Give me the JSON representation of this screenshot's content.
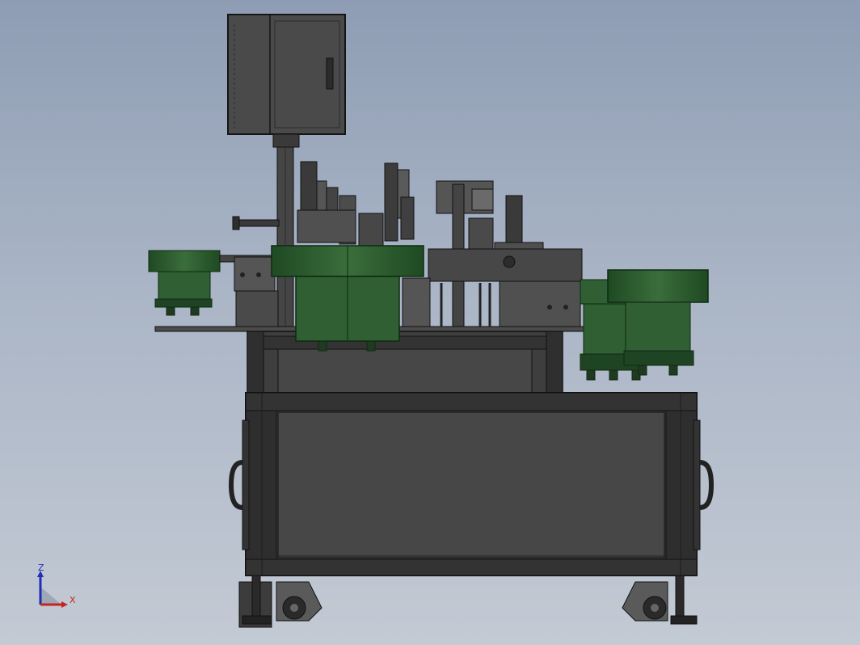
{
  "triad": {
    "z_label": "Z",
    "x_label": "X",
    "z_color": "#1f2fb8",
    "x_color": "#c8231e"
  },
  "colors": {
    "background_top": "#8e9db4",
    "background_bottom": "#c3cad4",
    "machine_body": "#3f3f3f",
    "frame_edge": "#1a1a1a",
    "feeder_bowl": "#2f5f32",
    "feeder_bowl_dark": "#1f4423"
  }
}
